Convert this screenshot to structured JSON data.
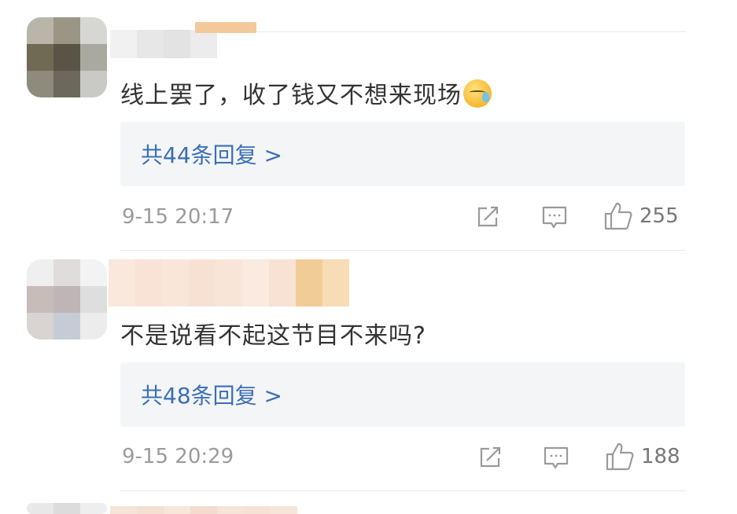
{
  "comments": [
    {
      "text": "线上罢了，收了钱又不想来现场",
      "emoji": "sweat-face-emoji",
      "replies_label": "共44条回复 >",
      "timestamp": "9-15 20:17",
      "likes": "255"
    },
    {
      "text": "不是说看不起这节目不来吗?",
      "replies_label": "共48条回复 >",
      "timestamp": "9-15 20:29",
      "likes": "188"
    }
  ],
  "colors": {
    "link": "#3b6fb5",
    "meta": "#9b9b9b",
    "reply_bg": "#f4f5f7"
  },
  "icons": [
    "share-icon",
    "comment-icon",
    "thumbs-up-icon"
  ]
}
